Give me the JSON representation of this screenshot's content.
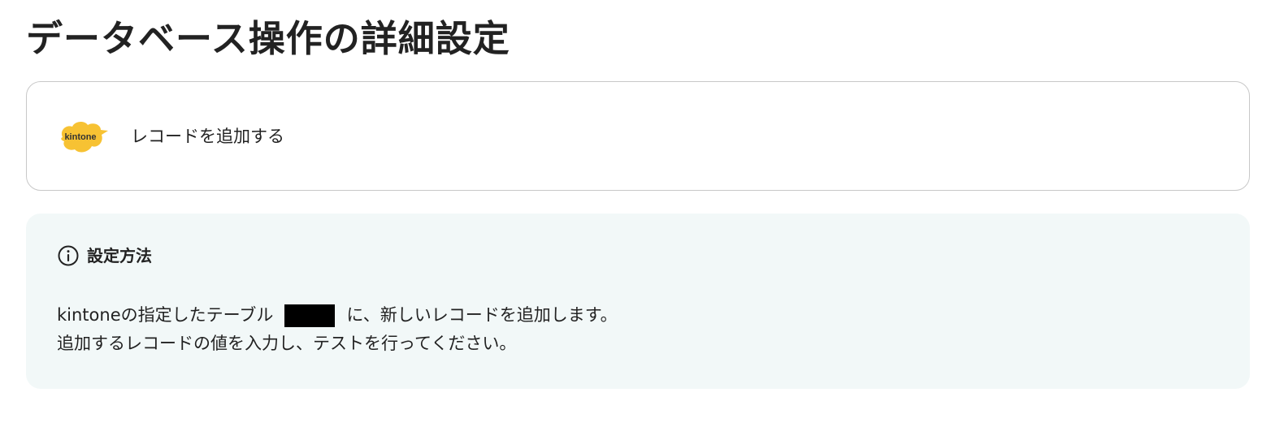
{
  "page": {
    "title": "データベース操作の詳細設定"
  },
  "operation": {
    "logo_text": "kintone",
    "logo_color": "#f7c233",
    "label": "レコードを追加する"
  },
  "info": {
    "icon": "info-icon",
    "title": "設定方法",
    "line1_before": "kintoneの指定したテーブル",
    "line1_after": "に、新しいレコードを追加します。",
    "line2": "追加するレコードの値を入力し、テストを行ってください。",
    "panel_color": "#f2f8f8"
  }
}
